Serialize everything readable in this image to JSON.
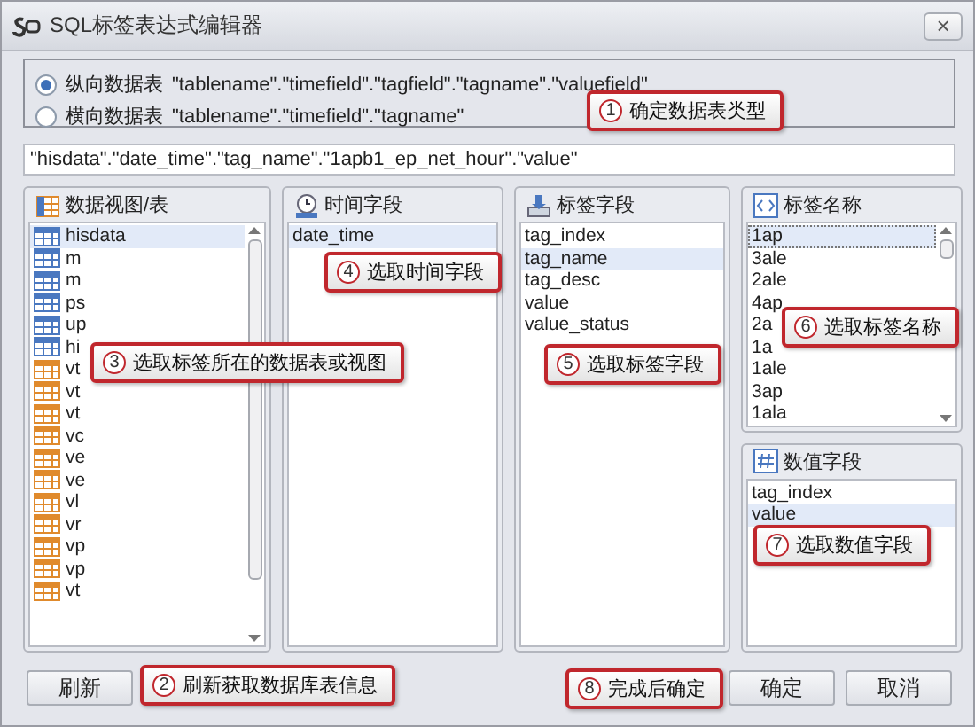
{
  "window": {
    "title": "SQL标签表达式编辑器",
    "close": "×"
  },
  "table_type": [
    {
      "label": "纵向数据表",
      "format": "\"tablename\".\"timefield\".\"tagfield\".\"tagname\".\"valuefield\"",
      "selected": true
    },
    {
      "label": "横向数据表",
      "format": "\"tablename\".\"timefield\".\"tagname\"",
      "selected": false
    }
  ],
  "expression": "\"hisdata\".\"date_time\".\"tag_name\".\"1apb1_ep_net_hour\".\"value\"",
  "panels": {
    "tables": {
      "title": "数据视图/表",
      "items": [
        {
          "text": "hisdata",
          "kind": "table",
          "selected": true
        },
        {
          "text": "m",
          "kind": "table",
          "selected": false
        },
        {
          "text": "m",
          "kind": "table",
          "selected": false
        },
        {
          "text": "ps",
          "kind": "table",
          "selected": false
        },
        {
          "text": "up",
          "kind": "table",
          "selected": false
        },
        {
          "text": "hi",
          "kind": "table",
          "selected": false
        },
        {
          "text": "vt",
          "kind": "view",
          "selected": false
        },
        {
          "text": "vt",
          "kind": "view",
          "selected": false
        },
        {
          "text": "vt",
          "kind": "view",
          "selected": false
        },
        {
          "text": "vc",
          "kind": "view",
          "selected": false
        },
        {
          "text": "ve",
          "kind": "view",
          "selected": false
        },
        {
          "text": "ve",
          "kind": "view",
          "selected": false
        },
        {
          "text": "vl",
          "kind": "view",
          "selected": false
        },
        {
          "text": "vr",
          "kind": "view",
          "selected": false
        },
        {
          "text": "vp",
          "kind": "view",
          "selected": false
        },
        {
          "text": "vp",
          "kind": "view",
          "selected": false
        },
        {
          "text": "vt",
          "kind": "view",
          "selected": false
        }
      ]
    },
    "time_field": {
      "title": "时间字段",
      "items": [
        {
          "text": "date_time",
          "selected": true
        }
      ]
    },
    "tag_field": {
      "title": "标签字段",
      "items": [
        {
          "text": "tag_index",
          "selected": false
        },
        {
          "text": "tag_name",
          "selected": true
        },
        {
          "text": "tag_desc",
          "selected": false
        },
        {
          "text": "value",
          "selected": false
        },
        {
          "text": "value_status",
          "selected": false
        }
      ]
    },
    "tag_name": {
      "title": "标签名称",
      "items": [
        {
          "text": "1ap",
          "selected": true
        },
        {
          "text": "3ale",
          "selected": false
        },
        {
          "text": "2ale",
          "selected": false
        },
        {
          "text": "4ap",
          "selected": false
        },
        {
          "text": "2a",
          "selected": false
        },
        {
          "text": "1a",
          "selected": false
        },
        {
          "text": "1ale",
          "selected": false
        },
        {
          "text": "3ap",
          "selected": false
        },
        {
          "text": "1ala",
          "selected": false
        }
      ]
    },
    "value_field": {
      "title": "数值字段",
      "items": [
        {
          "text": "tag_index",
          "selected": false
        },
        {
          "text": "value",
          "selected": true
        }
      ]
    }
  },
  "buttons": {
    "refresh": "刷新",
    "ok": "确定",
    "cancel": "取消"
  },
  "callouts": [
    {
      "number": "1",
      "text": "确定数据表类型"
    },
    {
      "number": "4",
      "text": "选取时间字段"
    },
    {
      "number": "6",
      "text": "选取标签名称"
    },
    {
      "number": "3",
      "text": "选取标签所在的数据表或视图"
    },
    {
      "number": "5",
      "text": "选取标签字段"
    },
    {
      "number": "7",
      "text": "选取数值字段"
    },
    {
      "number": "2",
      "text": "刷新获取数据库表信息"
    },
    {
      "number": "8",
      "text": "完成后确定"
    }
  ]
}
